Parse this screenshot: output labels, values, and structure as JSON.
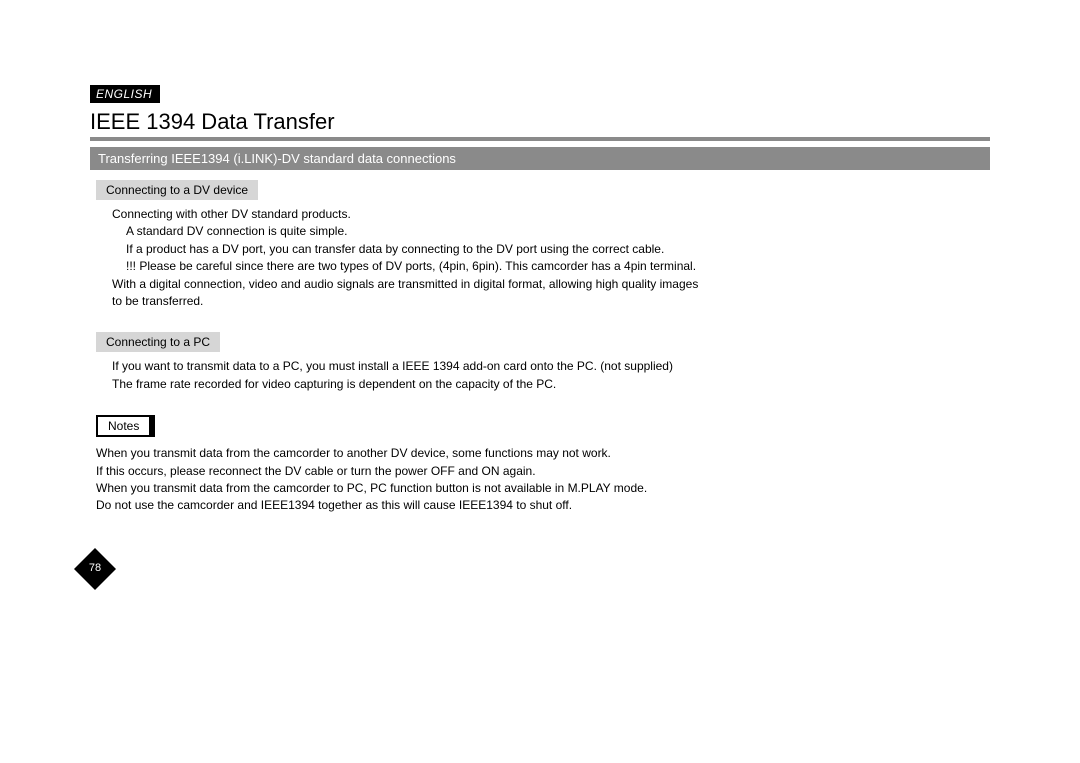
{
  "language_badge": "ENGLISH",
  "page_title": "IEEE 1394 Data Transfer",
  "subheader": "Transferring IEEE1394 (i.LINK)-DV standard data connections",
  "section1": {
    "label": "Connecting to a DV device",
    "lines": [
      "Connecting with other DV standard products.",
      "A standard DV connection is quite simple.",
      "If a product has a DV port, you can transfer data by connecting to the DV port using the correct cable.",
      "!!!  Please be careful since there are two types of DV ports, (4pin, 6pin). This camcorder has a 4pin terminal.",
      "With a digital connection, video and audio signals are transmitted in digital format, allowing high quality images",
      "to be transferred."
    ]
  },
  "section2": {
    "label": "Connecting to a PC",
    "lines": [
      "If you want to transmit data to a PC, you must install a IEEE 1394 add-on card onto the PC. (not supplied)",
      "The frame rate recorded for video capturing is dependent on the capacity of the PC."
    ]
  },
  "notes": {
    "label": "Notes",
    "lines": [
      "When you transmit data from the camcorder to another DV device, some functions may not work.",
      "If this occurs, please reconnect the DV cable or turn the power OFF and ON again.",
      "When you transmit data from the camcorder to PC, PC function button is not available in M.PLAY mode.",
      "Do not use the camcorder and IEEE1394 together as this will cause IEEE1394 to shut off."
    ]
  },
  "page_number": "78"
}
